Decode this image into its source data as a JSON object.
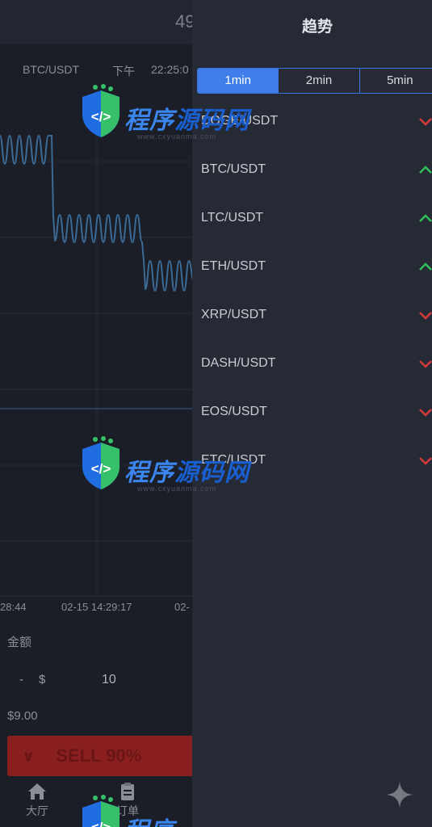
{
  "background": {
    "title": "49",
    "pair": "BTC/USDT",
    "ampm": "下午",
    "time": "22:25:0",
    "axis_labels": [
      "28:44",
      "02-15 14:29:17",
      "02-"
    ],
    "amount_label": "金额",
    "minus": "-",
    "currency": "$",
    "amount_value": "10",
    "fee": "$9.00",
    "sell_label": "SELL 90%",
    "tabs": [
      {
        "label": "大厅",
        "icon": "home-icon"
      },
      {
        "label": "订单",
        "icon": "clipboard-icon"
      }
    ]
  },
  "drawer": {
    "title": "趋势",
    "intervals": [
      {
        "label": "1min",
        "active": true
      },
      {
        "label": "2min",
        "active": false
      },
      {
        "label": "5min",
        "active": false
      }
    ],
    "pairs": [
      {
        "name": "DOGE/USDT",
        "trend": "down"
      },
      {
        "name": "BTC/USDT",
        "trend": "up"
      },
      {
        "name": "LTC/USDT",
        "trend": "up"
      },
      {
        "name": "ETH/USDT",
        "trend": "up"
      },
      {
        "name": "XRP/USDT",
        "trend": "down"
      },
      {
        "name": "DASH/USDT",
        "trend": "down"
      },
      {
        "name": "EOS/USDT",
        "trend": "down"
      },
      {
        "name": "ETC/USDT",
        "trend": "down"
      }
    ]
  },
  "watermark": {
    "text_a": "程序",
    "text_b": "源码网",
    "url": "www.cxyuanma.com"
  },
  "colors": {
    "up": "#2fbf5a",
    "down": "#d63a3a",
    "accent": "#3f7ee8",
    "chart_line": "#3b6a94"
  }
}
